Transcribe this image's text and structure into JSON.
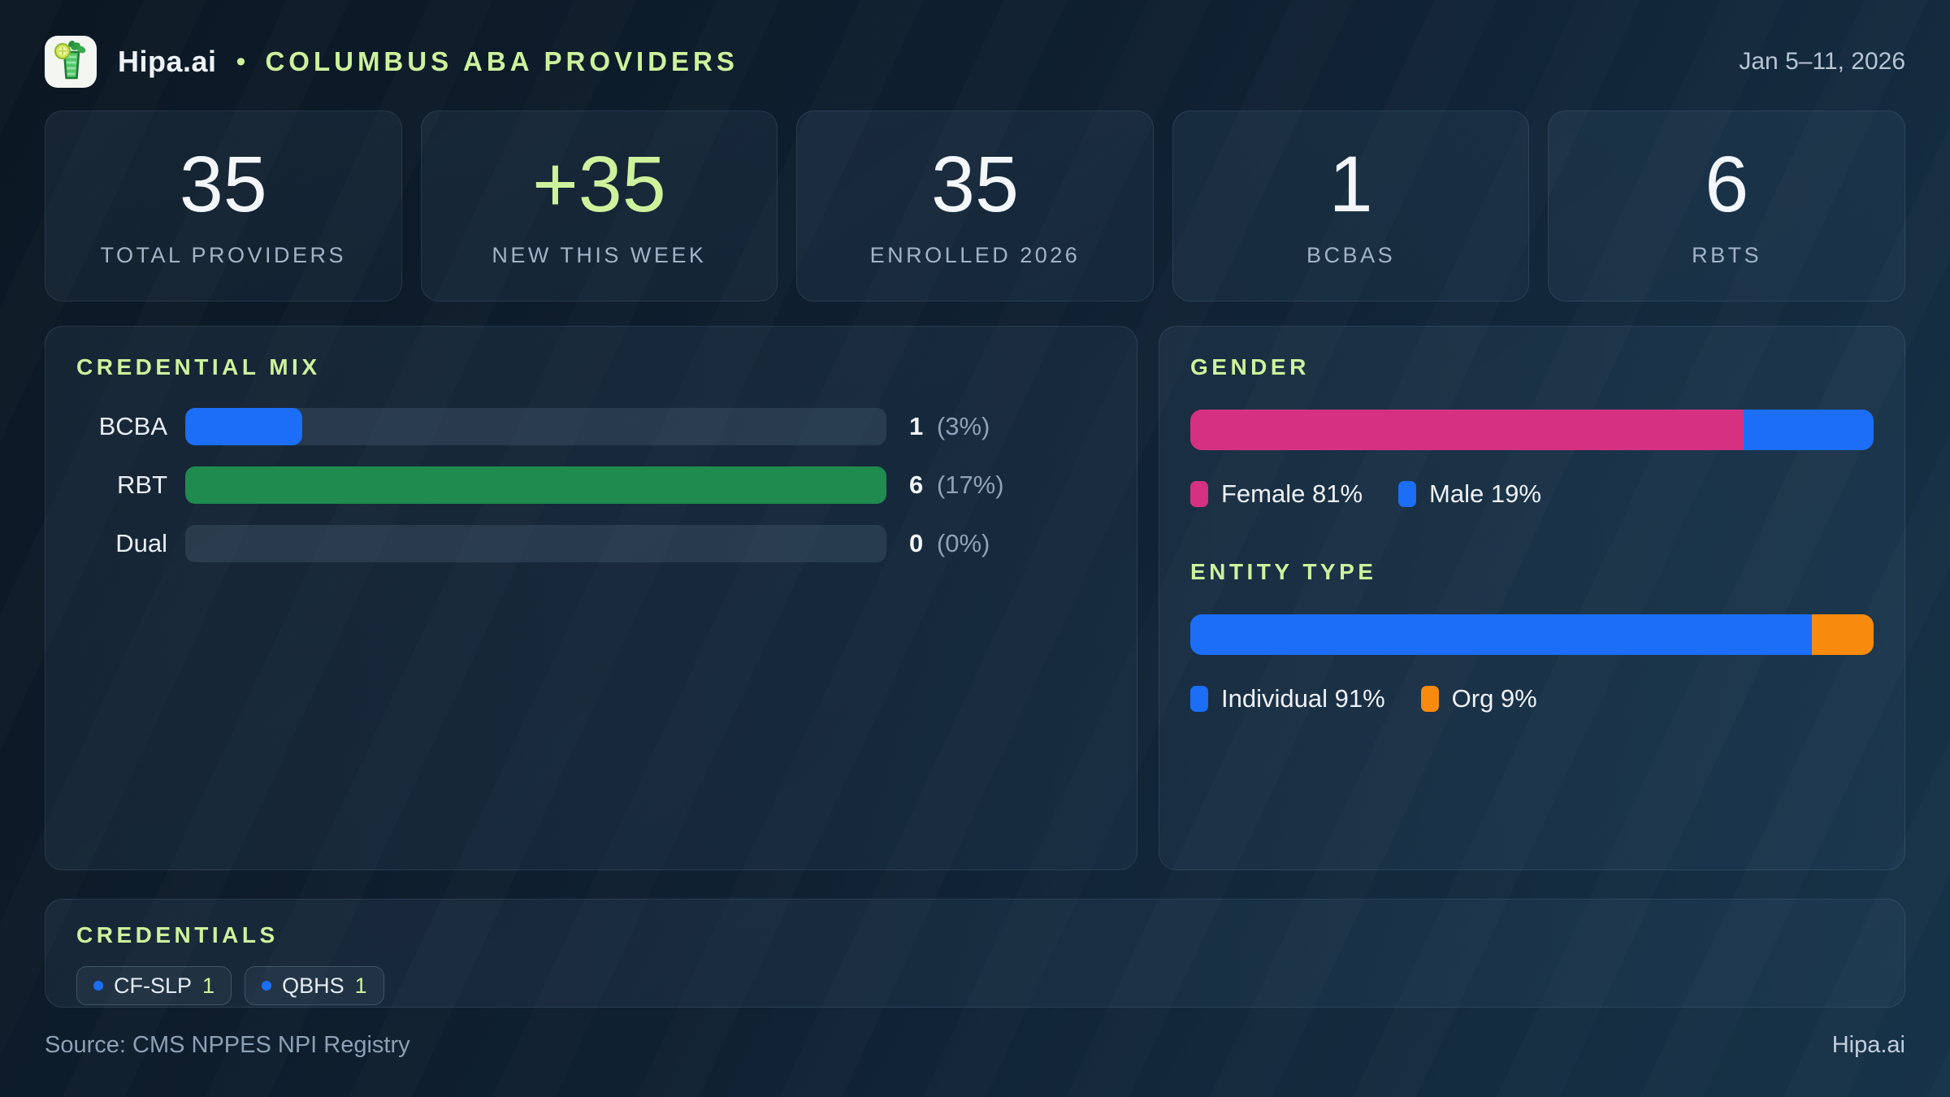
{
  "header": {
    "logo_icon": "mojito-app-icon",
    "brand": "Hipa.ai",
    "separator": "•",
    "title": "COLUMBUS ABA PROVIDERS",
    "date": "Jan 5–11, 2026"
  },
  "colors": {
    "accent_green": "#cdf29c",
    "blue": "#1b6ef5",
    "green": "#1f8b4e",
    "pink": "#d53180",
    "orange": "#f88a0e"
  },
  "stats": [
    {
      "value": "35",
      "label": "TOTAL PROVIDERS"
    },
    {
      "value": "+35",
      "label": "NEW THIS WEEK"
    },
    {
      "value": "35",
      "label": "ENROLLED 2026"
    },
    {
      "value": "1",
      "label": "BCBAS"
    },
    {
      "value": "6",
      "label": "RBTS"
    }
  ],
  "credential_mix": {
    "title": "CREDENTIAL MIX",
    "rows": [
      {
        "label": "BCBA",
        "value": "1",
        "pct": "(3%)",
        "bar_pct": 16.7,
        "color": "#1b6ef5"
      },
      {
        "label": "RBT",
        "value": "6",
        "pct": "(17%)",
        "bar_pct": 100,
        "color": "#1f8b4e"
      },
      {
        "label": "Dual",
        "value": "0",
        "pct": "(0%)",
        "bar_pct": 0,
        "color": "#1b6ef5"
      }
    ]
  },
  "gender": {
    "title": "GENDER",
    "segments": [
      {
        "name": "Female",
        "pct": 81,
        "color": "#d53180"
      },
      {
        "name": "Male",
        "pct": 19,
        "color": "#1b6ef5"
      }
    ],
    "legend": [
      {
        "label": "Female 81%",
        "color": "#d53180"
      },
      {
        "label": "Male 19%",
        "color": "#1b6ef5"
      }
    ]
  },
  "entity_type": {
    "title": "ENTITY TYPE",
    "segments": [
      {
        "name": "Individual",
        "pct": 91,
        "color": "#1b6ef5"
      },
      {
        "name": "Org",
        "pct": 9,
        "color": "#f88a0e"
      }
    ],
    "legend": [
      {
        "label": "Individual 91%",
        "color": "#1b6ef5"
      },
      {
        "label": "Org 9%",
        "color": "#f88a0e"
      }
    ]
  },
  "credentials": {
    "title": "CREDENTIALS",
    "dot_color": "#1b6ef5",
    "chips": [
      {
        "label": "CF-SLP",
        "count": "1"
      },
      {
        "label": "QBHS",
        "count": "1"
      }
    ]
  },
  "footer": {
    "source": "Source: CMS NPPES NPI Registry",
    "brand": "Hipa.ai"
  },
  "chart_data": [
    {
      "type": "bar",
      "orientation": "horizontal",
      "title": "CREDENTIAL MIX",
      "categories": [
        "BCBA",
        "RBT",
        "Dual"
      ],
      "values": [
        1,
        6,
        0
      ],
      "value_labels": [
        "1 (3%)",
        "6 (17%)",
        "0 (0%)"
      ],
      "xlim": [
        0,
        6
      ],
      "bar_colors": [
        "#1b6ef5",
        "#1f8b4e",
        "#1b6ef5"
      ],
      "grid": false,
      "note": "bar length scaled to max value 6; percentages are share of 35 total providers"
    },
    {
      "type": "bar",
      "subtype": "stacked-100pct",
      "title": "GENDER",
      "categories": [
        "Gender"
      ],
      "series": [
        {
          "name": "Female",
          "values": [
            81
          ],
          "color": "#d53180"
        },
        {
          "name": "Male",
          "values": [
            19
          ],
          "color": "#1b6ef5"
        }
      ],
      "legend_position": "bottom",
      "legend": [
        "Female 81%",
        "Male 19%"
      ]
    },
    {
      "type": "bar",
      "subtype": "stacked-100pct",
      "title": "ENTITY TYPE",
      "categories": [
        "Entity Type"
      ],
      "series": [
        {
          "name": "Individual",
          "values": [
            91
          ],
          "color": "#1b6ef5"
        },
        {
          "name": "Org",
          "values": [
            9
          ],
          "color": "#f88a0e"
        }
      ],
      "legend_position": "bottom",
      "legend": [
        "Individual 91%",
        "Org 9%"
      ]
    },
    {
      "type": "table",
      "title": "STAT CARDS",
      "categories": [
        "TOTAL PROVIDERS",
        "NEW THIS WEEK",
        "ENROLLED 2026",
        "BCBAS",
        "RBTS"
      ],
      "values": [
        35,
        35,
        35,
        1,
        6
      ]
    }
  ]
}
